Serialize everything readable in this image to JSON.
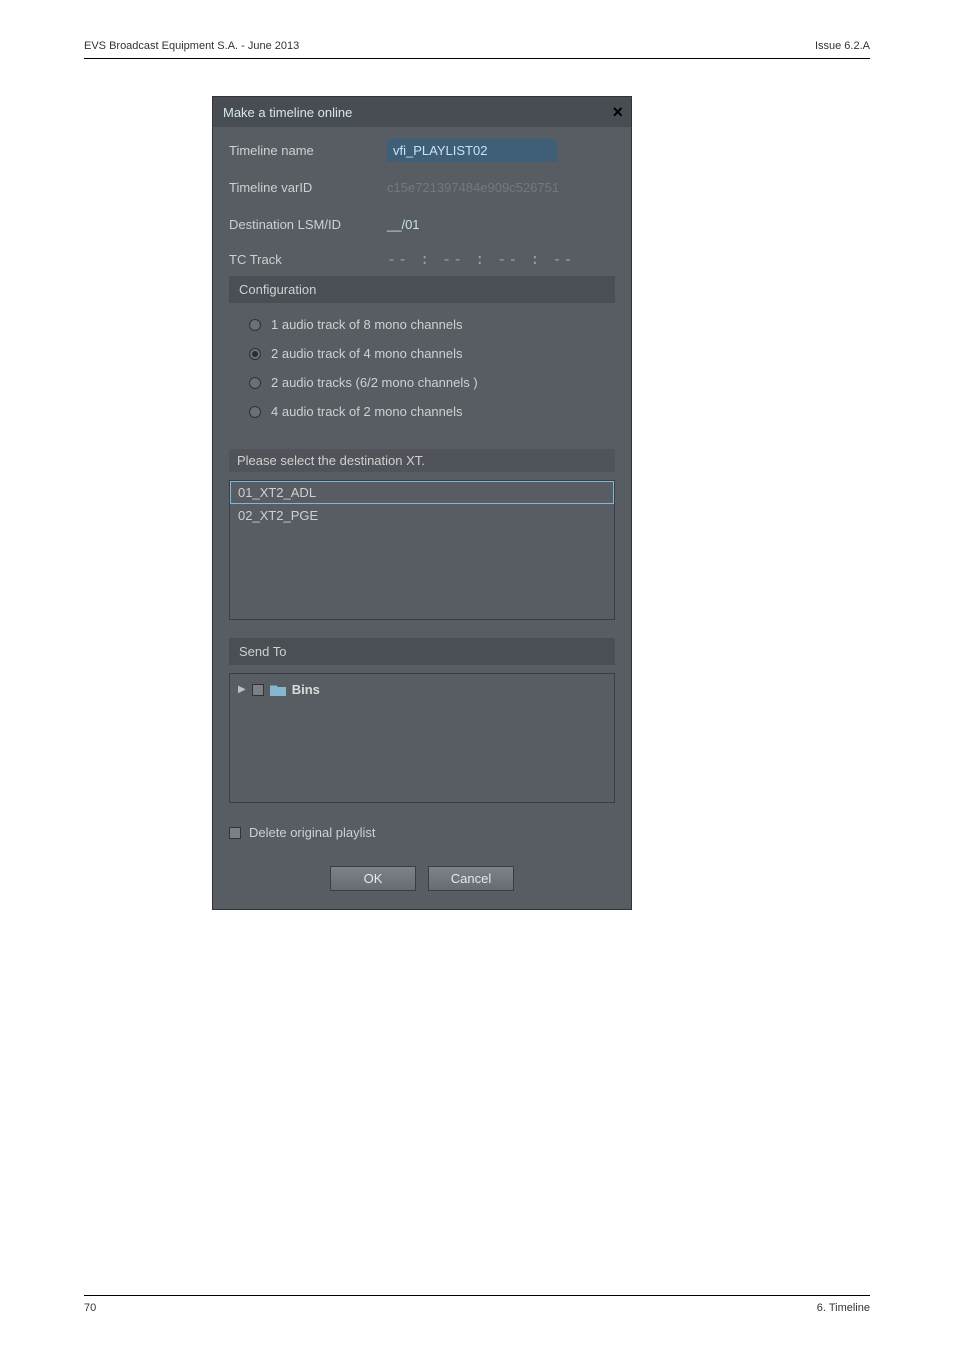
{
  "page_header": {
    "left": "EVS Broadcast Equipment S.A. - June 2013",
    "right": "Issue 6.2.A"
  },
  "dialog": {
    "title": "Make a timeline online",
    "timeline_name_label": "Timeline name",
    "timeline_name_value": "vfi_PLAYLIST02",
    "timeline_varid_label": "Timeline varID",
    "timeline_varid_value": "c15e721397484e909c526751",
    "dest_lsmid_label": "Destination LSM/ID",
    "dest_lsmid_value": "__/01",
    "tctrack_label": "TC Track",
    "tctrack_value": "-- : -- : -- : --",
    "config_header": "Configuration",
    "radios": [
      {
        "label": "1 audio track of 8 mono channels",
        "selected": false
      },
      {
        "label": "2 audio track of 4 mono channels",
        "selected": true
      },
      {
        "label": "2 audio tracks (6/2 mono channels )",
        "selected": false
      },
      {
        "label": "4 audio track of 2 mono channels",
        "selected": false
      }
    ],
    "dest_select_label": "Please select the destination XT.",
    "dest_items": [
      {
        "label": "01_XT2_ADL",
        "selected": true
      },
      {
        "label": "02_XT2_PGE",
        "selected": false
      }
    ],
    "sendto_header": "Send To",
    "bins_label": "Bins",
    "delete_label": "Delete original playlist",
    "ok_label": "OK",
    "cancel_label": "Cancel"
  },
  "page_footer": {
    "left": "70",
    "right": "6. Timeline"
  }
}
